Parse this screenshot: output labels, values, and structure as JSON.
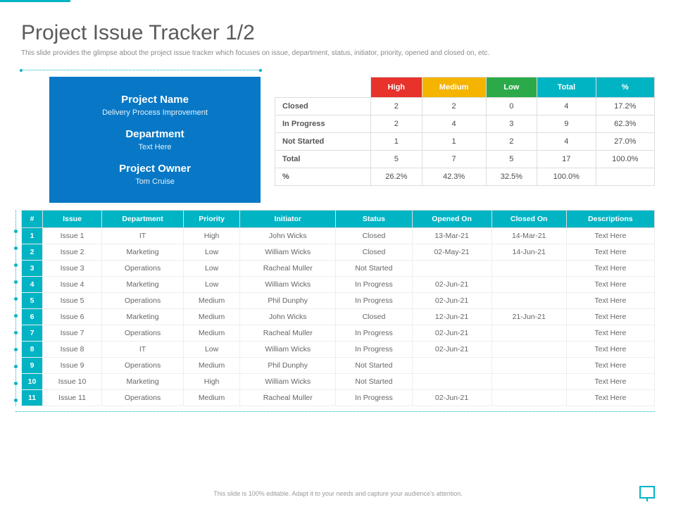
{
  "title": "Project Issue Tracker 1/2",
  "subtitle": "This slide provides the glimpse about the project issue tracker which focuses on issue, department, status, initiator, priority, opened and closed on, etc.",
  "info": {
    "projectNameLabel": "Project Name",
    "projectName": "Delivery  Process Improvement",
    "departmentLabel": "Department",
    "department": "Text Here",
    "ownerLabel": "Project  Owner",
    "owner": "Tom Cruise"
  },
  "summary": {
    "headers": [
      "High",
      "Medium",
      "Low",
      "Total",
      "%"
    ],
    "rows": [
      {
        "label": "Closed",
        "cells": [
          "2",
          "2",
          "0",
          "4",
          "17.2%"
        ]
      },
      {
        "label": "In Progress",
        "cells": [
          "2",
          "4",
          "3",
          "9",
          "62.3%"
        ]
      },
      {
        "label": "Not Started",
        "cells": [
          "1",
          "1",
          "2",
          "4",
          "27.0%"
        ]
      },
      {
        "label": "Total",
        "cells": [
          "5",
          "7",
          "5",
          "17",
          "100.0%"
        ]
      },
      {
        "label": "%",
        "cells": [
          "26.2%",
          "42.3%",
          "32.5%",
          "100.0%",
          ""
        ]
      }
    ]
  },
  "issues": {
    "headers": [
      "#",
      "Issue",
      "Department",
      "Priority",
      "Initiator",
      "Status",
      "Opened On",
      "Closed On",
      "Descriptions"
    ],
    "rows": [
      [
        "1",
        "Issue 1",
        "IT",
        "High",
        "John Wicks",
        "Closed",
        "13-Mar-21",
        "14-Mar-21",
        "Text Here"
      ],
      [
        "2",
        "Issue 2",
        "Marketing",
        "Low",
        "William Wicks",
        "Closed",
        "02-May-21",
        "14-Jun-21",
        "Text Here"
      ],
      [
        "3",
        "Issue 3",
        "Operations",
        "Low",
        "Racheal Muller",
        "Not Started",
        "",
        "",
        "Text Here"
      ],
      [
        "4",
        "Issue 4",
        "Marketing",
        "Low",
        "William Wicks",
        "In Progress",
        "02-Jun-21",
        "",
        "Text Here"
      ],
      [
        "5",
        "Issue 5",
        "Operations",
        "Medium",
        "Phil Dunphy",
        "In Progress",
        "02-Jun-21",
        "",
        "Text Here"
      ],
      [
        "6",
        "Issue 6",
        "Marketing",
        "Medium",
        "John Wicks",
        "Closed",
        "12-Jun-21",
        "21-Jun-21",
        "Text Here"
      ],
      [
        "7",
        "Issue 7",
        "Operations",
        "Medium",
        "Racheal Muller",
        "In Progress",
        "02-Jun-21",
        "",
        "Text Here"
      ],
      [
        "8",
        "Issue 8",
        "IT",
        "Low",
        "William Wicks",
        "In Progress",
        "02-Jun-21",
        "",
        "Text Here"
      ],
      [
        "9",
        "Issue 9",
        "Operations",
        "Medium",
        "Phil Dunphy",
        "Not Started",
        "",
        "",
        "Text Here"
      ],
      [
        "10",
        "Issue 10",
        "Marketing",
        "High",
        "William Wicks",
        "Not Started",
        "",
        "",
        "Text Here"
      ],
      [
        "11",
        "Issue 11",
        "Operations",
        "Medium",
        "Racheal Muller",
        "In Progress",
        "02-Jun-21",
        "",
        "Text Here"
      ]
    ]
  },
  "footer": "This slide is 100% editable. Adapt it to your needs and capture your audience's attention."
}
